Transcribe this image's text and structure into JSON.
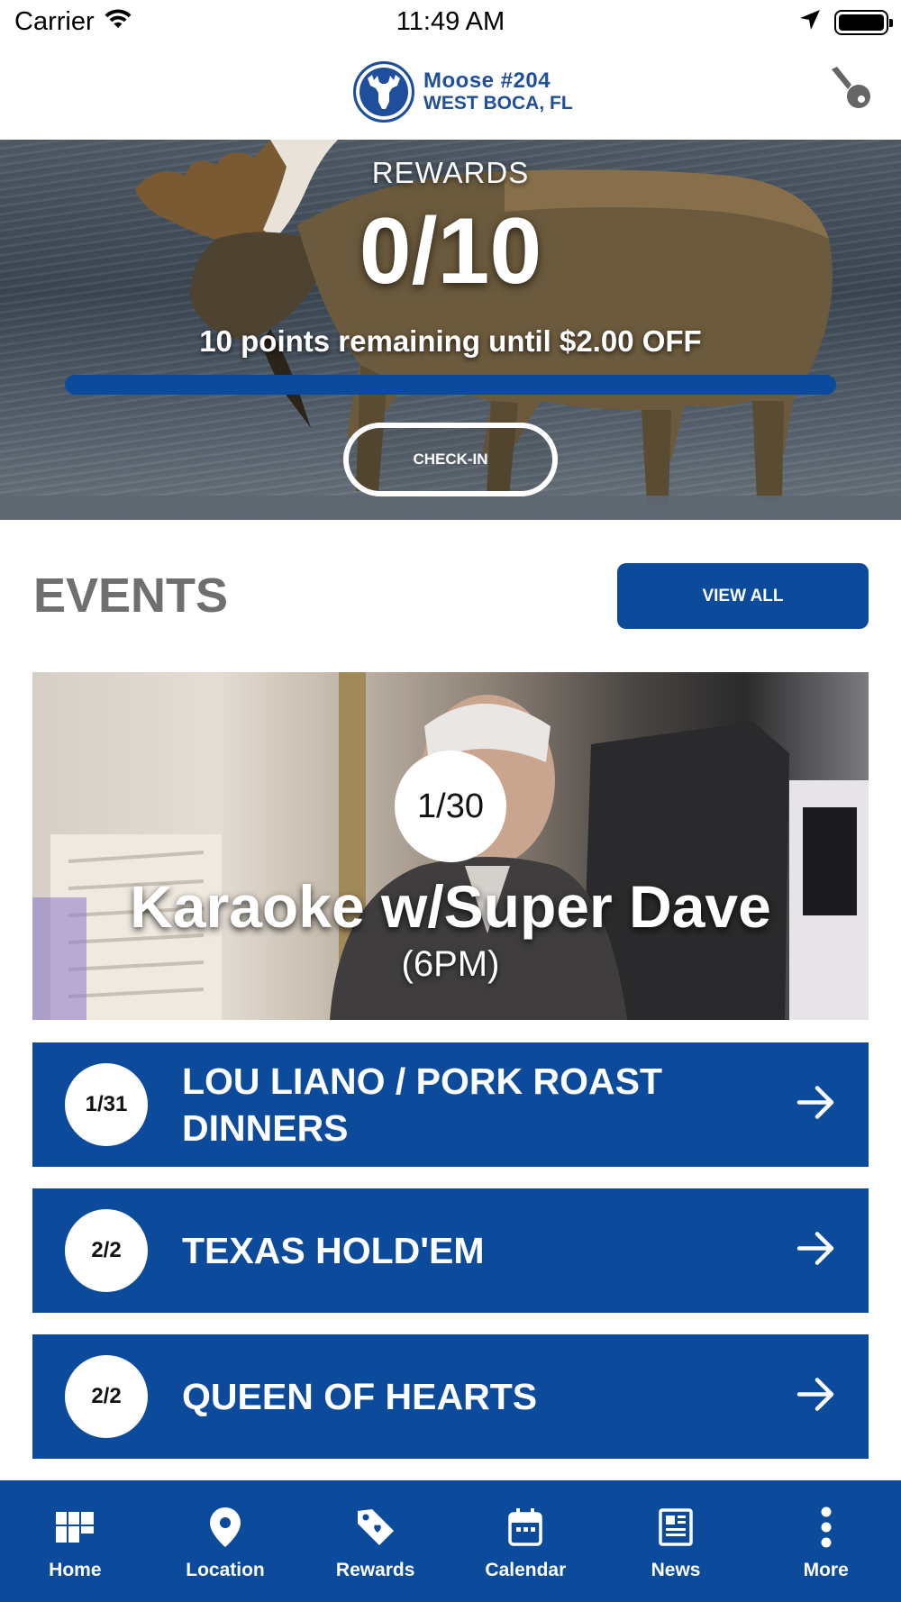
{
  "status_bar": {
    "carrier": "Carrier",
    "time": "11:49 AM"
  },
  "header": {
    "logo_line1": "Moose  #204",
    "logo_line2": "WEST BOCA, FL"
  },
  "rewards": {
    "label": "REWARDS",
    "count": "0/10",
    "points": 0,
    "points_goal": 10,
    "progress_fraction": 0,
    "remaining_text": "10 points remaining until $2.00 OFF",
    "checkin_label": "CHECK-IN"
  },
  "events": {
    "title": "EVENTS",
    "view_all_label": "VIEW ALL",
    "featured": {
      "date": "1/30",
      "title": "Karaoke w/Super Dave",
      "time": "(6PM)"
    },
    "list": [
      {
        "date": "1/31",
        "name": "LOU LIANO / PORK ROAST DINNERS"
      },
      {
        "date": "2/2",
        "name": "TEXAS HOLD'EM"
      },
      {
        "date": "2/2",
        "name": "QUEEN OF HEARTS"
      }
    ]
  },
  "tabs": [
    {
      "label": "Home",
      "icon": "home-grid-icon"
    },
    {
      "label": "Location",
      "icon": "location-pin-icon"
    },
    {
      "label": "Rewards",
      "icon": "tag-icon"
    },
    {
      "label": "Calendar",
      "icon": "calendar-icon"
    },
    {
      "label": "News",
      "icon": "newspaper-icon"
    },
    {
      "label": "More",
      "icon": "more-dots-icon"
    }
  ],
  "colors": {
    "brand_blue": "#0c4a9c",
    "logo_blue": "#1f4e9c",
    "events_title_gray": "#6f6f6f"
  }
}
